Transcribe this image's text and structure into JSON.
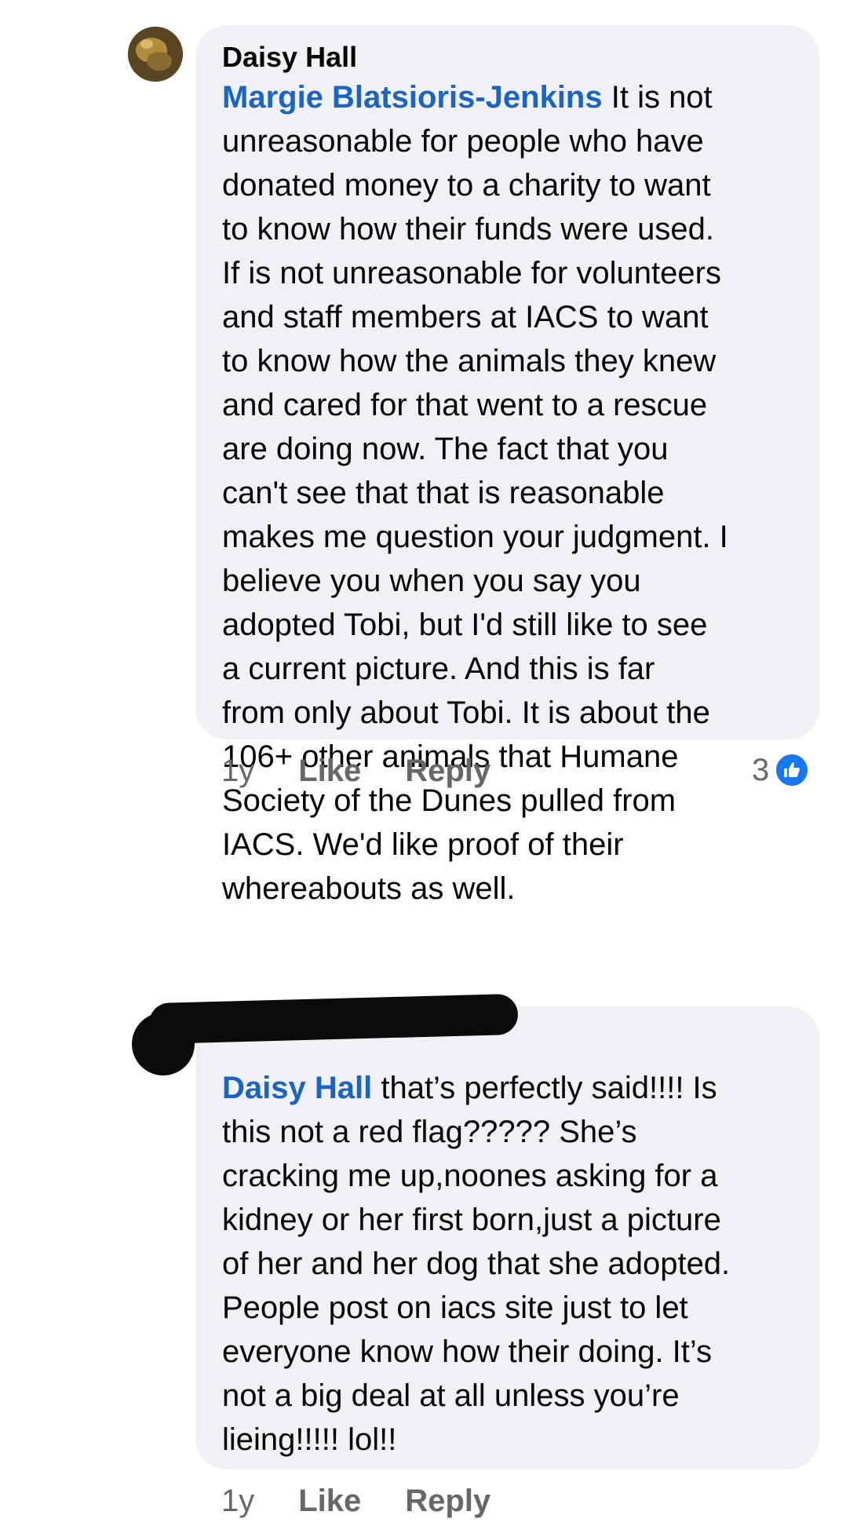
{
  "comments": [
    {
      "author": "Daisy Hall",
      "mention": "Margie Blatsioris-Jenkins",
      "text": " It is not\nunreasonable for people who have\ndonated money to a charity to want\nto know how their funds were used.\nIf is not unreasonable for volunteers\nand staff members at IACS to want\nto know how the animals they knew\nand cared for that went to a rescue\nare doing now. The fact that you\ncan't see that that is reasonable\nmakes me question your judgment. I\nbelieve you when you say you\nadopted Tobi, but I'd still like to see\na current picture. And this is far\nfrom only about Tobi. It is about the\n106+ other animals that Humane\nSociety of the Dunes pulled from\nIACS. We'd like proof of their\nwhereabouts as well.",
      "time": "1y",
      "like_label": "Like",
      "reply_label": "Reply",
      "reaction_count": "3",
      "reaction_icon": "thumbs-up-icon"
    },
    {
      "mention": "Daisy Hall",
      "text": " that’s perfectly said!!!!  Is\nthis not a red flag?????  She’s\ncracking me up,noones asking for a\nkidney or her first born,just a picture\nof her and her dog that she adopted.\nPeople post on iacs site just to let\neveryone know how their doing. It’s\nnot a big deal at all unless you’re\nlieing!!!!!  lol!!",
      "time": "1y",
      "like_label": "Like",
      "reply_label": "Reply"
    }
  ],
  "colors": {
    "bubble": "#eff1f4",
    "mention": "#1b64c3",
    "meta": "#65676b",
    "like_blue": "#1877f2"
  }
}
